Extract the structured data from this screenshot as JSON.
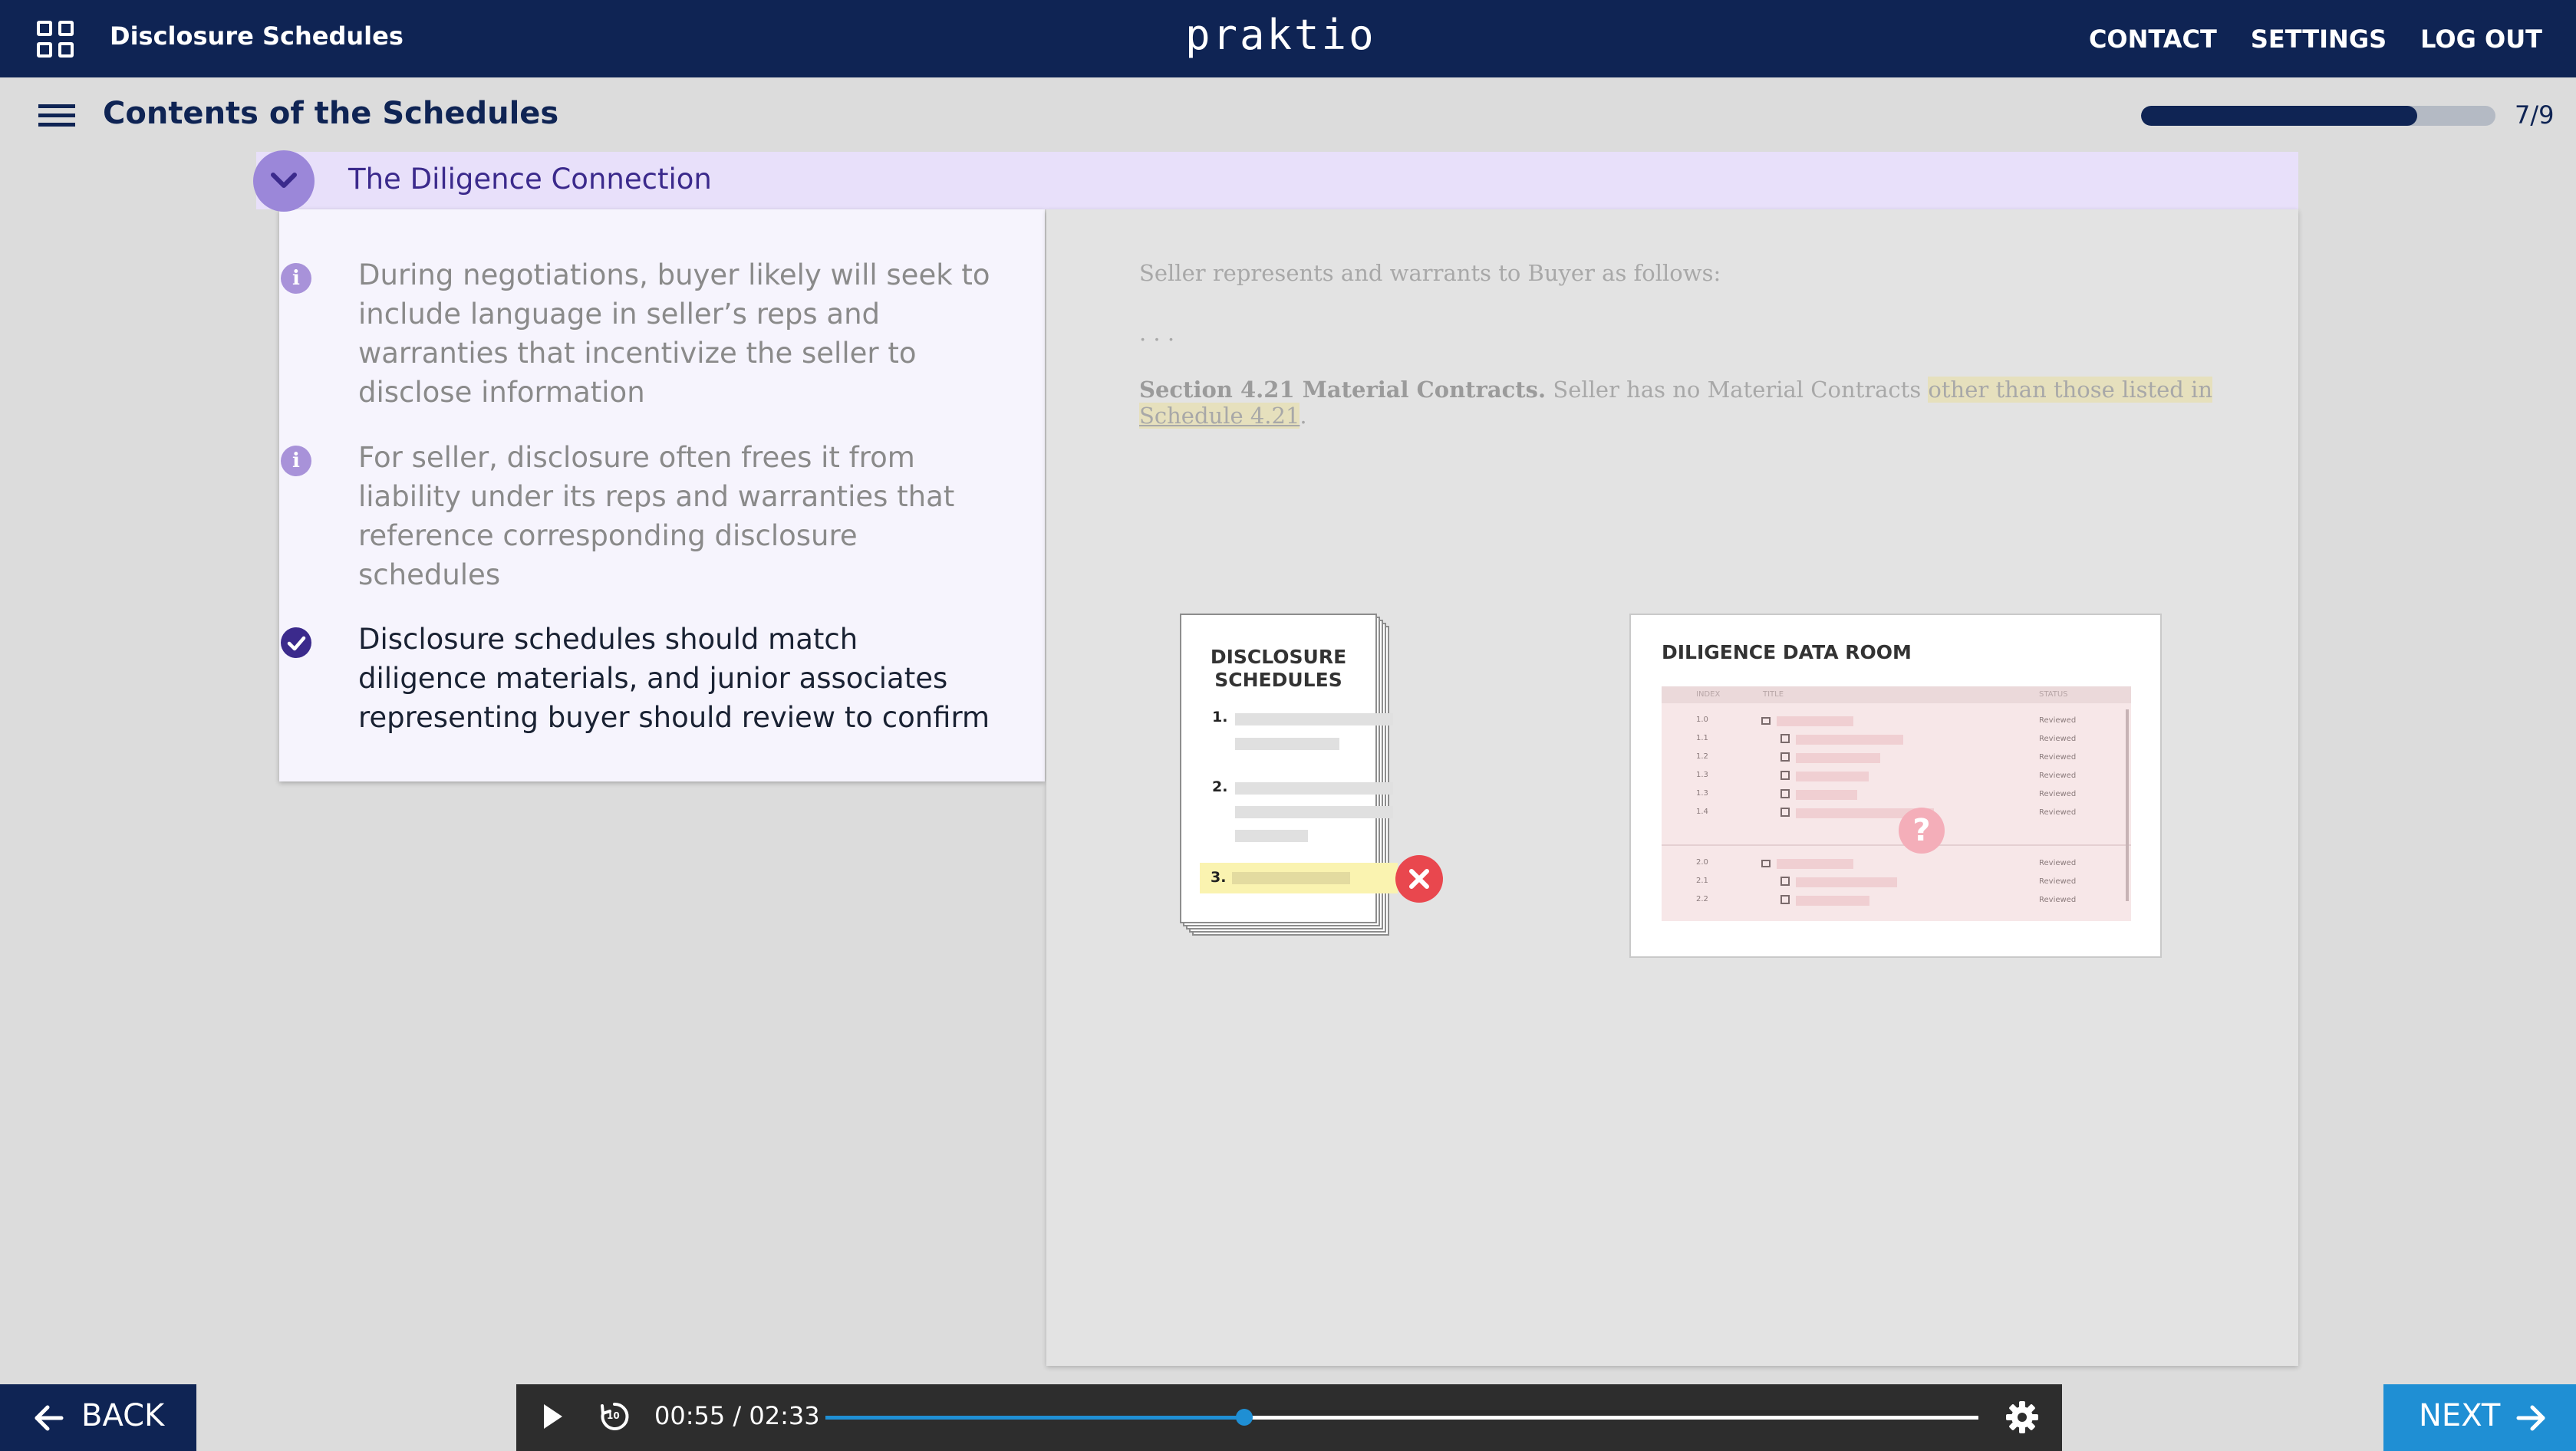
{
  "header": {
    "app_title": "Disclosure Schedules",
    "logo": "praktio",
    "nav": [
      "CONTACT",
      "SETTINGS",
      "LOG OUT"
    ]
  },
  "subheader": {
    "section_title": "Contents of the Schedules",
    "progress_label": "7/9",
    "progress_fraction": 0.78
  },
  "accordion": {
    "title": "The Diligence Connection",
    "bullets": [
      {
        "icon": "info-icon",
        "text": "During negotiations, buyer likely will seek to include language in seller’s reps and warranties that incentivize the seller to disclose information"
      },
      {
        "icon": "info-icon",
        "text": "For seller, disclosure often frees it from liability under its reps and warranties that reference corresponding disclosure schedules"
      },
      {
        "icon": "check-icon",
        "text": "Disclosure schedules should match diligence materials, and junior associates representing buyer should review to confirm"
      }
    ]
  },
  "legal_text": {
    "intro": "Seller represents and warrants to Buyer as follows:",
    "ellipsis": ". . .",
    "section_heading": "Section 4.21 Material Contracts.",
    "section_body": " Seller has no Material Contracts ",
    "highlight_pre": "other than those listed in ",
    "highlight_link": "Schedule 4.21",
    "end": "."
  },
  "illustration_schedules": {
    "title_line1": "DISCLOSURE",
    "title_line2": "SCHEDULES",
    "items": [
      "1.",
      "2.",
      "3."
    ],
    "error_icon": "x-icon"
  },
  "illustration_dataroom": {
    "title": "DILIGENCE DATA ROOM",
    "columns": [
      "INDEX",
      "TITLE",
      "STATUS"
    ],
    "rows": [
      {
        "index": "1.0",
        "type": "folder",
        "status": "Reviewed"
      },
      {
        "index": "1.1",
        "type": "file",
        "status": "Reviewed"
      },
      {
        "index": "1.2",
        "type": "file",
        "status": "Reviewed"
      },
      {
        "index": "1.3",
        "type": "file",
        "status": "Reviewed"
      },
      {
        "index": "1.3",
        "type": "file",
        "status": "Reviewed"
      },
      {
        "index": "1.4",
        "type": "file",
        "status": "Reviewed"
      },
      {
        "index": "2.0",
        "type": "folder",
        "status": "Reviewed"
      },
      {
        "index": "2.1",
        "type": "file",
        "status": "Reviewed"
      },
      {
        "index": "2.2",
        "type": "file",
        "status": "Reviewed"
      }
    ],
    "question_icon": "question-icon",
    "question_mark": "?"
  },
  "footer": {
    "back_label": "BACK",
    "next_label": "NEXT"
  },
  "player": {
    "time": "00:55 / 02:33",
    "played_fraction": 0.363,
    "replay_label": "10"
  },
  "colors": {
    "navy": "#0f2454",
    "accent_purple": "#3b2a8c",
    "next_blue": "#1f8fd4",
    "error_red": "#e9474e"
  }
}
